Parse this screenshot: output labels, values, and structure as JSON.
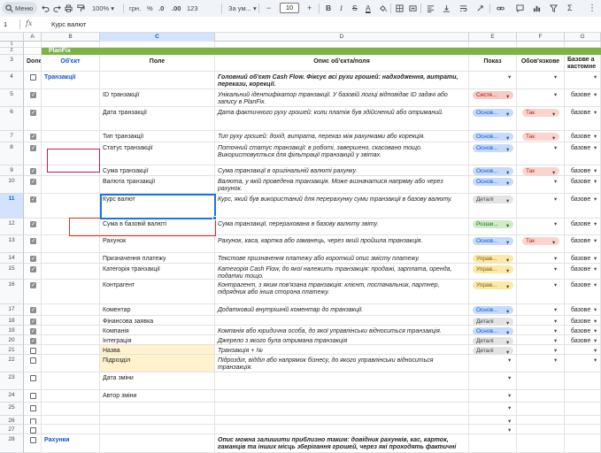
{
  "toolbar": {
    "menu_label": "Меню",
    "zoom": "100%",
    "currency": "грн.",
    "percent": "%",
    "decimal_decrease": ".0",
    "decimal_increase": ".00",
    "format_number": "123",
    "font": "За ум...",
    "minus": "−",
    "font_size": "10",
    "plus": "+",
    "bold": "B",
    "italic": "I",
    "strike": "S",
    "text_color": "A",
    "sigma": "Σ"
  },
  "formula_bar": {
    "cell_ref": "1",
    "fx": "fx",
    "value": "Курс валют"
  },
  "columns": [
    "A",
    "B",
    "C",
    "D",
    "E",
    "F",
    "G"
  ],
  "selected_column": "C",
  "selected_row": "11",
  "row_numbers_top": [
    "1",
    "2",
    "3"
  ],
  "band": "PlanFix",
  "header_row": {
    "done": "Done",
    "object": "Об'єкт",
    "field": "Поле",
    "desc": "Опис об'єкта/поля",
    "show": "Показ",
    "required": "Обов'язкове",
    "base_line1": "Базове а",
    "base_line2": "кастомне"
  },
  "colors": {
    "band_green": "#7cb342",
    "object_blue": "#1155cc",
    "field_highlight": "#fff2cc",
    "selection_blue": "#1a73e8",
    "box_red": "#d93025",
    "box_magenta": "#c2185b"
  },
  "chip_colors": {
    "red": {
      "bg": "#f9cbc7",
      "fg": "#a50e0e"
    },
    "blue": {
      "bg": "#c5dafc",
      "fg": "#0b57d0"
    },
    "grey": {
      "bg": "#e3e3e3",
      "fg": "#3c4043"
    },
    "green": {
      "bg": "#d0ecc2",
      "fg": "#137333"
    },
    "yellow": {
      "bg": "#fde8a6",
      "fg": "#7a5b00"
    },
    "pink": {
      "bg": "#fdd3cd",
      "fg": "#b3261e"
    }
  },
  "required_color": "pink",
  "rows": [
    {
      "num": "4",
      "done": false,
      "object": "Транзакції",
      "desc": "Головний об'єкт Cash Flow. Фіксує всі рухи грошей: надходження, витрати, перекази, корекції.",
      "desc_bold": true,
      "show": "",
      "required": "",
      "base": ""
    },
    {
      "num": "5",
      "done": true,
      "field": "ID транзакції",
      "desc": "Унікальний ідентифікатор транзакції. У базовій логіці відповідає ID задачі або запису в PlanFix.",
      "show": "Систе...",
      "show_color": "red",
      "required": "",
      "base": "базове"
    },
    {
      "num": "6",
      "done": true,
      "field": "Дата транзакції",
      "desc": "Дата фактичного руху грошей: коли платіж був здійснений або отриманий.",
      "show": "Основ...",
      "show_color": "blue",
      "required": "Так",
      "base": "базове"
    },
    {
      "num": "7",
      "done": true,
      "field": "Тип транзакції",
      "desc": "Тип руху грошей: дохід, витрата, переказ між рахунками або корекція.",
      "show": "Основ...",
      "show_color": "blue",
      "required": "Так",
      "base": "базове"
    },
    {
      "num": "8",
      "done": true,
      "field": "Статус транзакції",
      "desc": "Поточний статус транзакції: в роботі, завершено, скасовано тощо. Використовується для фільтрації транзакцій у звітах.",
      "show": "Основ...",
      "show_color": "blue",
      "required": "",
      "base": "базове"
    },
    {
      "num": "9",
      "done": true,
      "field": "Сума транзакції",
      "desc": "Сума транзакції в оригінальній валюті рахунку.",
      "show": "Основ...",
      "show_color": "blue",
      "required": "Так",
      "base": "базове"
    },
    {
      "num": "10",
      "done": true,
      "field": "Валюта транзакції",
      "desc": "Валюта, у якій проведена транзакція. Може визначатися напряму або через рахунок.",
      "show": "Основ...",
      "show_color": "blue",
      "required": "",
      "base": "базове"
    },
    {
      "num": "11",
      "done": true,
      "field": "Курс валют",
      "desc": "Курс, який був використаний для перерахунку суми транзакції в базову валюту.",
      "show": "Деталі",
      "show_color": "grey",
      "required": "",
      "base": "базове"
    },
    {
      "num": "12",
      "done": true,
      "field": "Сума в базовій валюті",
      "desc": "Сума транзакції, перерахована в базову валюту звіту.",
      "show": "Розши...",
      "show_color": "green",
      "required": "",
      "base": "базове"
    },
    {
      "num": "13",
      "done": true,
      "field": "Рахунок",
      "desc": "Рахунок, каса, картка або гаманець, через який пройшла транзакція.",
      "show": "Основ...",
      "show_color": "blue",
      "required": "Так",
      "base": "базове"
    },
    {
      "num": "14",
      "done": true,
      "field": "Призначення платежу",
      "desc": "Текстове призначення платежу або короткий опис змісту платежу.",
      "show": "Управ...",
      "show_color": "yellow",
      "required": "",
      "base": "базове"
    },
    {
      "num": "15",
      "done": true,
      "field": "Категорія транзакції",
      "desc": "Категорія Cash Flow, до якої належить транзакція: продажі, зарплата, оренда, податки тощо.",
      "show": "Управ...",
      "show_color": "yellow",
      "required": "",
      "base": "базове"
    },
    {
      "num": "16",
      "done": true,
      "field": "Контрагент",
      "desc": "Контрагент, з яким пов'язана транзакція: клієнт, постачальник, партнер, підрядник або інша сторона платежу.",
      "show": "Управ...",
      "show_color": "yellow",
      "required": "",
      "base": "базове"
    },
    {
      "num": "17",
      "done": true,
      "field": "Коментар",
      "desc": "Додатковий внутрішній коментар до транзакції.",
      "show": "Основ...",
      "show_color": "blue",
      "required": "",
      "base": "базове"
    },
    {
      "num": "18",
      "done": true,
      "field": "Фінансова заявка",
      "desc": "",
      "show": "Деталі",
      "show_color": "grey",
      "required": "",
      "base": "базове"
    },
    {
      "num": "19",
      "done": true,
      "field": "Компанія",
      "desc": "Компанія або юридична особа, до якої управлінськи відноситься транзакція.",
      "show": "Основ...",
      "show_color": "blue",
      "required": "",
      "base": "базове"
    },
    {
      "num": "20",
      "done": true,
      "field": "Інтеграція",
      "desc": "Джерело з якого була отримана транзакція",
      "show": "Деталі",
      "show_color": "grey",
      "required": "",
      "base": "базове"
    },
    {
      "num": "21",
      "done": false,
      "field": "Назва",
      "field_highlight": true,
      "desc": "Транзакція + №",
      "show": "Деталі",
      "show_color": "grey",
      "required": "",
      "base": ""
    },
    {
      "num": "22",
      "done": false,
      "field": "Підрозділ",
      "field_highlight": true,
      "desc": "Підрозділ, відділ або напрямок бізнесу, до якого управлінськи відноситься транзакція.",
      "show": "",
      "required": "",
      "base": ""
    },
    {
      "num": "23",
      "done": false,
      "field": "Дата зміни",
      "show": ""
    },
    {
      "num": "24",
      "done": false,
      "field": "Автор зміни",
      "show": ""
    },
    {
      "num": "25",
      "done": false,
      "show": ""
    },
    {
      "num": "26",
      "done": false,
      "show": ""
    },
    {
      "num": "27",
      "done": false,
      "show": ""
    },
    {
      "num": "28",
      "done": false,
      "object": "Рахунки",
      "desc": "Опис можна залишити приблизно таким: довідник рахунків, кас, карток, гаманців та інших місць зберігання грошей, через які проходять фактичні",
      "desc_bold": true
    }
  ]
}
